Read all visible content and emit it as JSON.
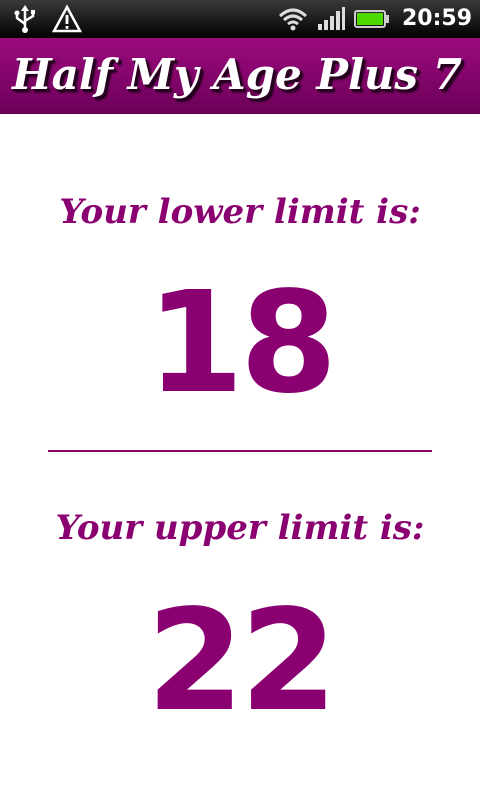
{
  "status_bar": {
    "left_icons": [
      "usb-icon",
      "warning-icon"
    ],
    "right_icons": [
      "wifi-icon",
      "signal-icon",
      "battery-icon"
    ],
    "time": "20:59"
  },
  "header": {
    "title": "Half My Age Plus 7"
  },
  "lower": {
    "label": "Your lower limit is:",
    "value": "18"
  },
  "upper": {
    "label": "Your upper limit is:",
    "value": "22"
  },
  "colors": {
    "accent": "#8a0070",
    "header_top": "#9c0a7e",
    "header_bottom": "#6c0059",
    "status_bar": "#000000",
    "battery": "#4cd900"
  }
}
